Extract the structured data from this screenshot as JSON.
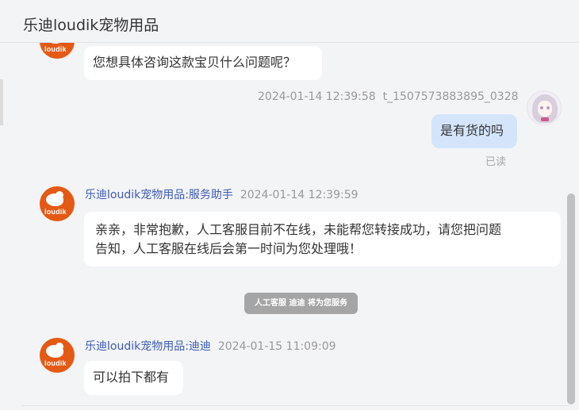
{
  "header": {
    "title": "乐迪loudik宠物用品"
  },
  "shop_logo_text": "loudik",
  "messages": [
    {
      "text": "您想具体咨询这款宝贝什么问题呢？"
    },
    {
      "time": "2024-01-14 12:39:58",
      "sender": "t_1507573883895_0328",
      "text": "是有货的吗",
      "status": "已读"
    },
    {
      "sender": "乐迪loudik宠物用品:服务助手",
      "time": "2024-01-14 12:39:59",
      "line1": "亲亲，非常抱歉，人工客服目前不在线，未能帮您转接成功，请您把问题",
      "line2": "告知，人工客服在线后会第一时间为您处理哦！"
    },
    {
      "sender": "乐迪loudik宠物用品:迪迪",
      "time": "2024-01-15 11:09:09",
      "text": "可以拍下都有"
    }
  ],
  "system_tip": "人工客服 迪迪 将为您服务"
}
